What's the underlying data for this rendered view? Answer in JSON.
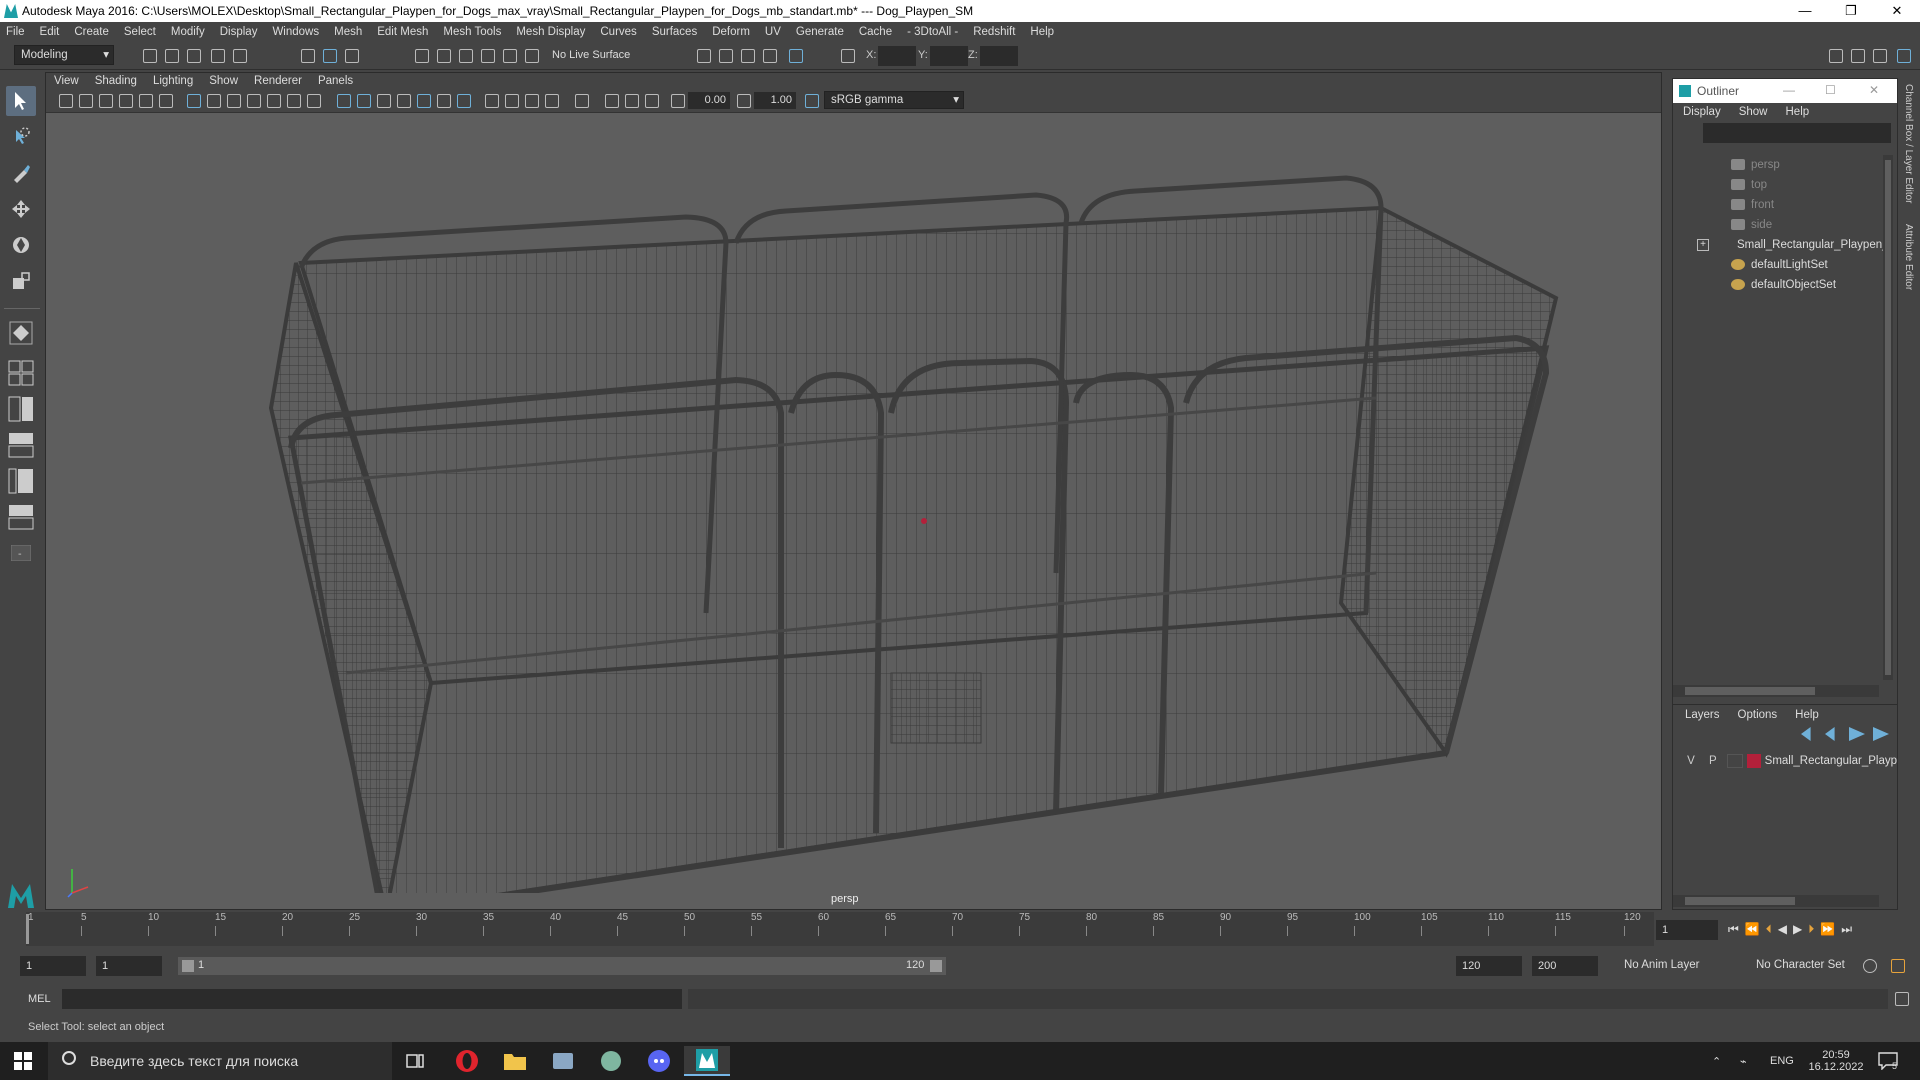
{
  "window": {
    "title": "Autodesk Maya 2016: C:\\Users\\MOLEX\\Desktop\\Small_Rectangular_Playpen_for_Dogs_max_vray\\Small_Rectangular_Playpen_for_Dogs_mb_standart.mb*   ---   Dog_Playpen_SM",
    "minimize": "—",
    "maximize": "❐",
    "close": "✕"
  },
  "menubar": [
    "File",
    "Edit",
    "Create",
    "Select",
    "Modify",
    "Display",
    "Windows",
    "Mesh",
    "Edit Mesh",
    "Mesh Tools",
    "Mesh Display",
    "Curves",
    "Surfaces",
    "Deform",
    "UV",
    "Generate",
    "Cache",
    "- 3DtoAll -",
    "Redshift",
    "Help"
  ],
  "status_line": {
    "mode": "Modeling",
    "live_surface": "No Live Surface",
    "x_label": "X:",
    "y_label": "Y:",
    "z_label": "Z:"
  },
  "panel": {
    "menu": [
      "View",
      "Shading",
      "Lighting",
      "Show",
      "Renderer",
      "Panels"
    ],
    "exposure": "0.00",
    "gamma": "1.00",
    "color_space": "sRGB gamma",
    "camera": "persp"
  },
  "outliner": {
    "title": "Outliner",
    "menu": [
      "Display",
      "Show",
      "Help"
    ],
    "items": [
      {
        "label": "persp",
        "dim": true,
        "icon": "camera-icon"
      },
      {
        "label": "top",
        "dim": true,
        "icon": "camera-icon"
      },
      {
        "label": "front",
        "dim": true,
        "icon": "camera-icon"
      },
      {
        "label": "side",
        "dim": true,
        "icon": "camera-icon"
      },
      {
        "label": "Small_Rectangular_Playpen_",
        "dim": false,
        "icon": "group-icon",
        "expandable": true
      },
      {
        "label": "defaultLightSet",
        "dim": false,
        "icon": "set-icon"
      },
      {
        "label": "defaultObjectSet",
        "dim": false,
        "icon": "set-icon"
      }
    ]
  },
  "layers": {
    "menu": [
      "Layers",
      "Options",
      "Help"
    ],
    "rows": [
      {
        "v": "V",
        "p": "P",
        "name": "Small_Rectangular_Playp",
        "color": "#b3203a"
      }
    ]
  },
  "side_tabs": [
    "Channel Box / Layer Editor",
    "Attribute Editor"
  ],
  "timeline": {
    "ticks": [
      "5",
      "10",
      "15",
      "20",
      "25",
      "30",
      "35",
      "40",
      "45",
      "50",
      "55",
      "60",
      "65",
      "70",
      "75",
      "80",
      "85",
      "90",
      "95",
      "100",
      "105",
      "110",
      "115",
      "120"
    ],
    "start_marker": "1",
    "current_frame": "1"
  },
  "range": {
    "start": "1",
    "playback_start": "1",
    "slider_start": "1",
    "slider_end": "120",
    "playback_end": "120",
    "end": "200",
    "anim_layer": "No Anim Layer",
    "character_set": "No Character Set"
  },
  "command_line": {
    "label": "MEL"
  },
  "help_line": "Select Tool: select an object",
  "taskbar": {
    "search_placeholder": "Введите здесь текст для поиска",
    "lang": "ENG",
    "time": "20:59",
    "date": "16.12.2022",
    "notifications": "5"
  },
  "colors": {
    "accent": "#5d6e80",
    "maya_teal": "#1e9ea6",
    "layer_red": "#b3203a"
  }
}
